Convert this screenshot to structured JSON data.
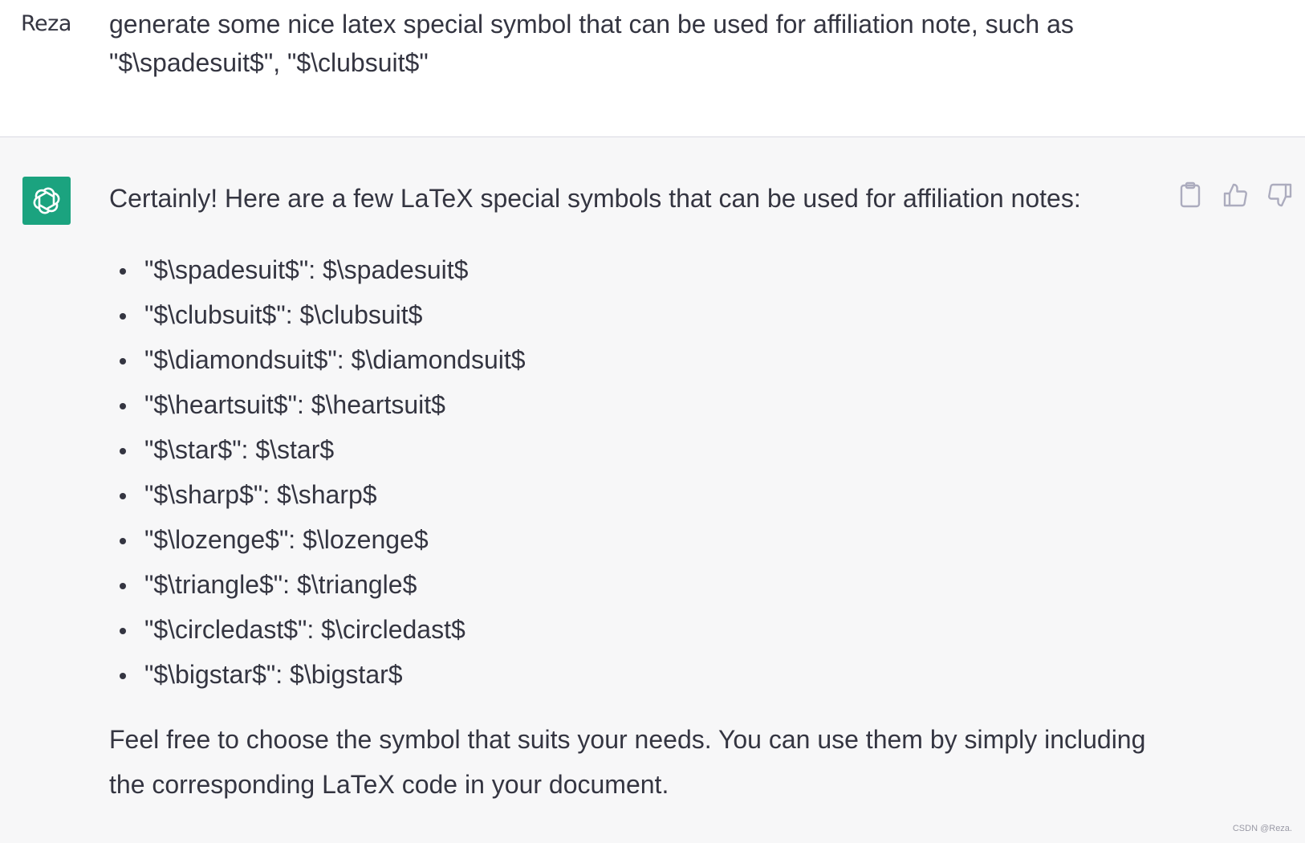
{
  "user": {
    "name": "Reza",
    "message": "generate some nice latex special symbol that can be used for affiliation note, such as \"$\\spadesuit$\", \"$\\clubsuit$\""
  },
  "assistant": {
    "intro": "Certainly! Here are a few LaTeX special symbols that can be used for affiliation notes:",
    "items": [
      "\"$\\spadesuit$\": $\\spadesuit$",
      "\"$\\clubsuit$\": $\\clubsuit$",
      "\"$\\diamondsuit$\": $\\diamondsuit$",
      "\"$\\heartsuit$\": $\\heartsuit$",
      "\"$\\star$\": $\\star$",
      "\"$\\sharp$\": $\\sharp$",
      "\"$\\lozenge$\": $\\lozenge$",
      "\"$\\triangle$\": $\\triangle$",
      "\"$\\circledast$\": $\\circledast$",
      "\"$\\bigstar$\": $\\bigstar$"
    ],
    "outro": "Feel free to choose the symbol that suits your needs. You can use them by simply including the corresponding LaTeX code in your document."
  },
  "actions": {
    "icons": [
      "clipboard-icon",
      "thumbs-up-icon",
      "thumbs-down-icon"
    ]
  },
  "colors": {
    "user_bg": "#ffffff",
    "assistant_bg": "#f7f7f8",
    "avatar_bg": "#1ba37f",
    "text": "#343541",
    "icon": "#acacbe"
  },
  "watermark": "CSDN @Reza."
}
